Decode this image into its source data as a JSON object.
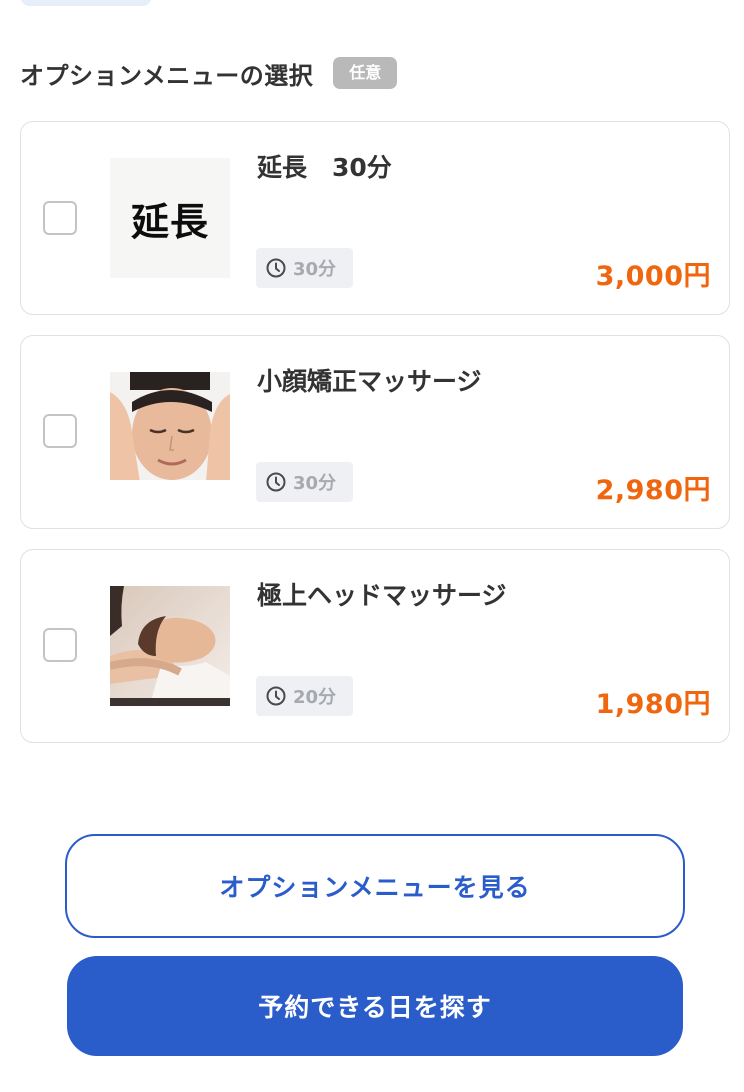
{
  "section": {
    "title": "オプションメニューの選択",
    "badge": "任意"
  },
  "options": [
    {
      "name": "延長　30分",
      "thumb_text": "延長",
      "duration": "30分",
      "price": "3,000円",
      "checked": false
    },
    {
      "name": "小顔矯正マッサージ",
      "duration": "30分",
      "price": "2,980円",
      "checked": false
    },
    {
      "name": "極上ヘッドマッサージ",
      "duration": "20分",
      "price": "1,980円",
      "checked": false
    }
  ],
  "buttons": {
    "view_options": "オプションメニューを見る",
    "find_date": "予約できる日を探す"
  },
  "colors": {
    "accent_blue": "#2a5cca",
    "price_orange": "#f0660f",
    "badge_gray": "#b9b9b9"
  },
  "icons": {
    "duration": "clock-icon"
  }
}
